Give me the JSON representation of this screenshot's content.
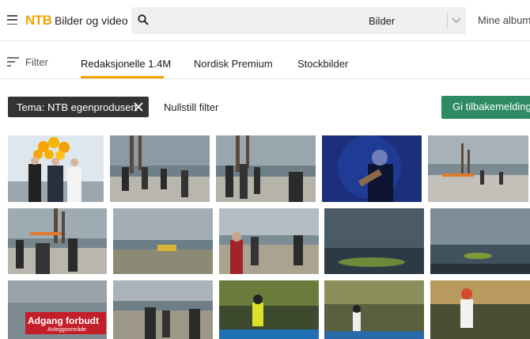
{
  "header": {
    "logo_text": "NTB",
    "app_title": "Bilder og video",
    "search": {
      "value": "",
      "placeholder": ""
    },
    "media_type": "Bilder",
    "mine_album": "Mine album",
    "brand_color": "#f0a400"
  },
  "filter_bar": {
    "filter_label": "Filter",
    "tabs": [
      {
        "label": "Redaksjonelle 1.4M",
        "active": true
      },
      {
        "label": "Nordisk Premium",
        "active": false
      },
      {
        "label": "Stockbilder",
        "active": false
      }
    ]
  },
  "active_filters": {
    "chip_label": "Tema: NTB egenprodusert",
    "reset_label": "Nullstill filter",
    "feedback_label": "Gi tilbakemelding",
    "feedback_color": "#2e8a63"
  },
  "gallery": {
    "sign_text": "Adgang forbudt",
    "sign_subtext": "Anleggsområde"
  },
  "icons": [
    "hamburger-icon",
    "search-icon",
    "chevron-down-icon",
    "filter-icon",
    "close-icon"
  ]
}
